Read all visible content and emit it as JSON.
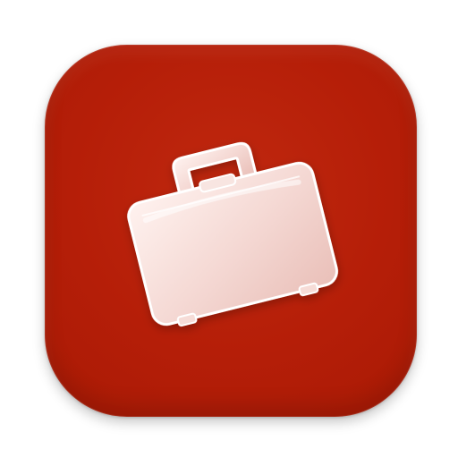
{
  "app_icon": {
    "name": "briefcase",
    "icon": "briefcase-icon",
    "colors": {
      "background": "#b51e08",
      "glyph_fill": "#f7dcd8",
      "glyph_highlight": "#fff5f3",
      "glyph_stroke": "#ffffff"
    }
  }
}
